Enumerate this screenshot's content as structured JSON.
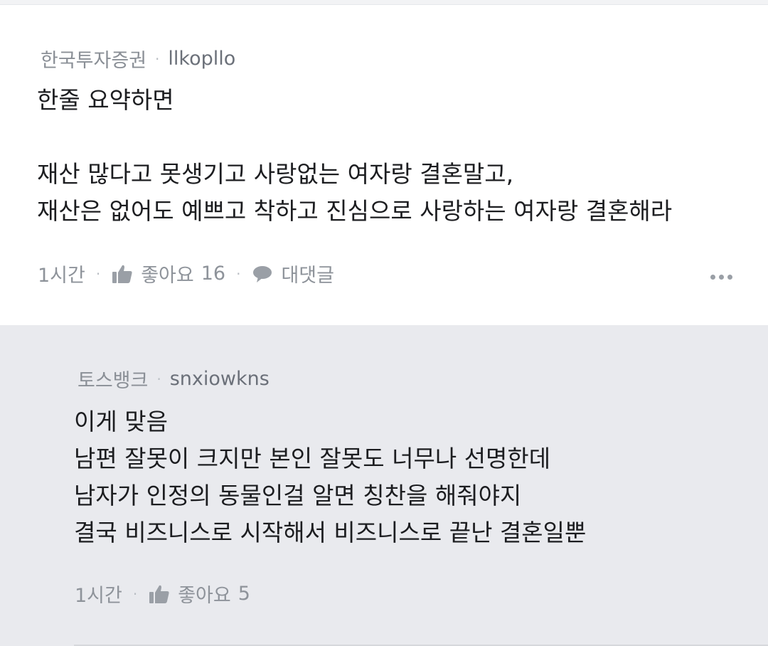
{
  "comments": [
    {
      "broker": "한국투자증권",
      "username": "llkopllo",
      "body": "한줄 요약하면\n\n재산 많다고 못생기고 사랑없는 여자랑 결혼말고,\n재산은 없어도 예쁘고 착하고 진심으로 사랑하는 여자랑 결혼해라",
      "time": "1시간",
      "like_label": "좋아요",
      "like_count": "16",
      "reply_label": "대댓글"
    },
    {
      "broker": "토스뱅크",
      "username": "snxiowkns",
      "body": "이게 맞음\n남편 잘못이 크지만 본인 잘못도 너무나 선명한데\n남자가 인정의 동물인걸 알면 칭찬을 해줘야지\n결국 비즈니스로 시작해서 비즈니스로 끝난 결혼일뿐",
      "time": "1시간",
      "like_label": "좋아요",
      "like_count": "5"
    }
  ],
  "separator": "·",
  "icons": {
    "like": "thumbs-up-icon",
    "reply": "speech-bubble-icon",
    "more": "more-dots-icon"
  }
}
